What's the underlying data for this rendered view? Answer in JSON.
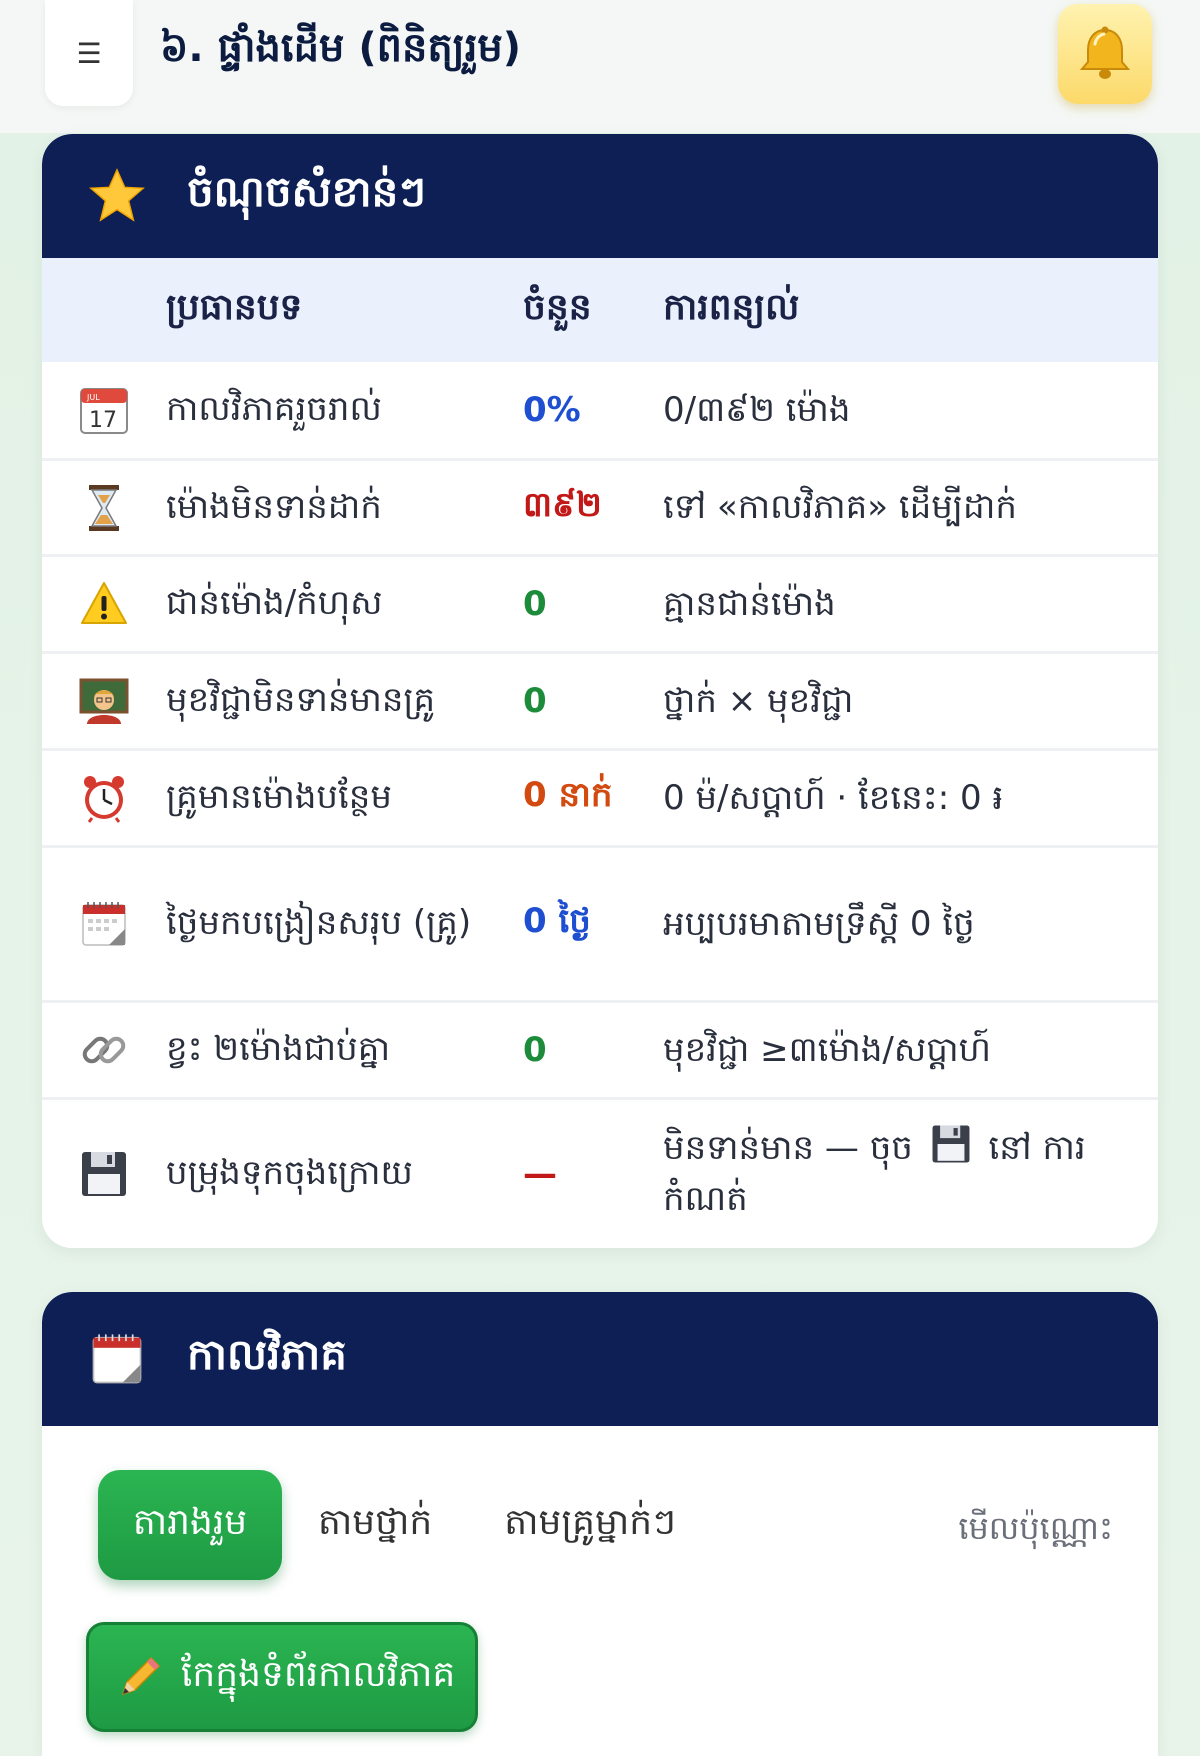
{
  "header": {
    "title": "៦. ផ្ទាំងដើម (ពិនិត្យរួម)",
    "menu_icon": "☰"
  },
  "summary": {
    "title": "ចំណុចសំខាន់ៗ",
    "columns": [
      "ប្រធានបទ",
      "ចំនួន",
      "ការពន្យល់"
    ],
    "rows": [
      {
        "icon": "calendar-17-icon",
        "topic": "កាលវិភាគរួចរាល់",
        "count": "0%",
        "desc": "0/៣៩២ ម៉ោង"
      },
      {
        "icon": "hourglass-icon",
        "topic": "ម៉ោងមិនទាន់ដាក់",
        "count": "៣៩២",
        "desc": "ទៅ «កាលវិភាគ» ដើម្បីដាក់"
      },
      {
        "icon": "warning-icon",
        "topic": "ជាន់ម៉ោង/កំហុស",
        "count": "0",
        "desc": "គ្មានជាន់ម៉ោង"
      },
      {
        "icon": "teacher-icon",
        "topic": "មុខវិជ្ជាមិនទាន់មានគ្រូ",
        "count": "0",
        "desc": "ថ្នាក់ × មុខវិជ្ជា"
      },
      {
        "icon": "alarm-clock-icon",
        "topic": "គ្រូមានម៉ោងបន្ថែម",
        "count": "0 នាក់",
        "desc": "0 ម៉/សប្តាហ៍ · ខែនេះ: 0 ៛"
      },
      {
        "icon": "tear-off-calendar-icon",
        "topic": "ថ្ងៃមកបង្រៀនសរុប (គ្រូ)",
        "count": "0 ថ្ងៃ",
        "desc": "អប្បបរមាតាមទ្រឹស្តី 0 ថ្ងៃ"
      },
      {
        "icon": "link-icon",
        "topic": "ខ្វះ ២ម៉ោងជាប់គ្នា",
        "count": "0",
        "desc": "មុខវិជ្ជា ≥៣ម៉ោង/សប្តាហ៍"
      },
      {
        "icon": "floppy-disk-icon",
        "topic": "បម្រុងទុកចុងក្រោយ",
        "count": "—",
        "desc_pre": "មិនទាន់មាន — ចុច",
        "desc_post": "នៅ ការកំណត់"
      }
    ]
  },
  "timetable": {
    "title": "កាលវិភាគ",
    "tabs": [
      "តារាងរួម",
      "តាមថ្នាក់",
      "តាមគ្រូម្នាក់ៗ"
    ],
    "view_only": "មើលប៉ុណ្ណោះ",
    "edit_button": "កែក្នុងទំព័រកាលវិភាគ"
  },
  "colors": {
    "navy": "#0d1f55",
    "blue": "#1f4fd1",
    "red": "#c21818",
    "green": "#1c8c3b",
    "orange": "#d34a10",
    "button_green": "#22a84a"
  }
}
